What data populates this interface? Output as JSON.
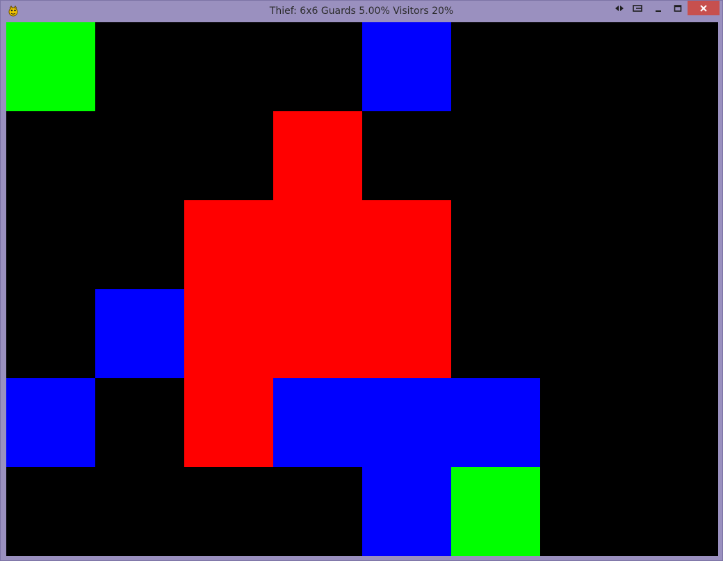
{
  "window": {
    "title": "Thief: 6x6 Guards 5.00% Visitors 20%",
    "icon": "pygame-snake-icon",
    "controls": [
      "extend-icon",
      "snap-icon",
      "minimize-icon",
      "maximize-icon",
      "close-icon"
    ]
  },
  "colors": {
    "background": "#000000",
    "green": "#00ff00",
    "blue": "#0000ff",
    "red": "#ff0000"
  },
  "grid": {
    "columns": 8,
    "rows": 6,
    "tiles": [
      {
        "col": 0,
        "row": 0,
        "color": "green"
      },
      {
        "col": 4,
        "row": 0,
        "color": "blue"
      },
      {
        "col": 3,
        "row": 1,
        "color": "red"
      },
      {
        "col": 2,
        "row": 2,
        "color": "red"
      },
      {
        "col": 3,
        "row": 2,
        "color": "red"
      },
      {
        "col": 4,
        "row": 2,
        "color": "red"
      },
      {
        "col": 1,
        "row": 3,
        "color": "blue"
      },
      {
        "col": 2,
        "row": 3,
        "color": "red"
      },
      {
        "col": 3,
        "row": 3,
        "color": "red"
      },
      {
        "col": 4,
        "row": 3,
        "color": "red"
      },
      {
        "col": 0,
        "row": 4,
        "color": "blue"
      },
      {
        "col": 2,
        "row": 4,
        "color": "red"
      },
      {
        "col": 3,
        "row": 4,
        "color": "blue"
      },
      {
        "col": 4,
        "row": 4,
        "color": "blue"
      },
      {
        "col": 5,
        "row": 4,
        "color": "blue"
      },
      {
        "col": 4,
        "row": 5,
        "color": "blue"
      },
      {
        "col": 5,
        "row": 5,
        "color": "green"
      }
    ]
  }
}
